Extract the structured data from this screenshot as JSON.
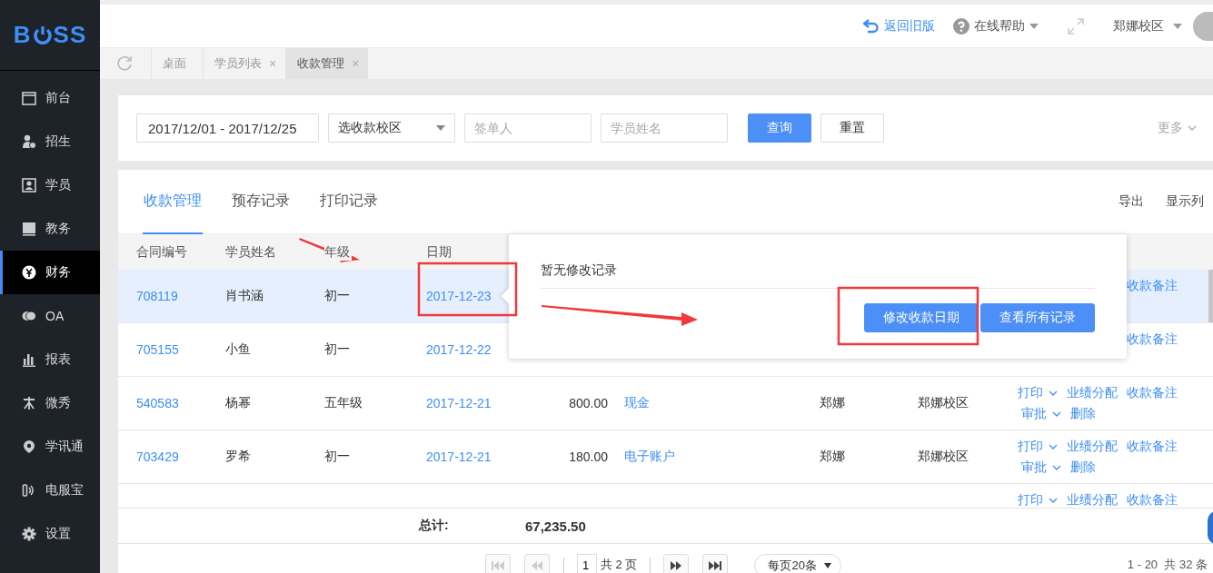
{
  "logo": {
    "left": "B",
    "right": "SS"
  },
  "sidebar": {
    "items": [
      {
        "label": "前台",
        "selected": false
      },
      {
        "label": "招生",
        "selected": false
      },
      {
        "label": "学员",
        "selected": false
      },
      {
        "label": "教务",
        "selected": false
      },
      {
        "label": "财务",
        "selected": true
      },
      {
        "label": "OA",
        "selected": false
      },
      {
        "label": "报表",
        "selected": false
      },
      {
        "label": "微秀",
        "selected": false
      },
      {
        "label": "学讯通",
        "selected": false
      },
      {
        "label": "电服宝",
        "selected": false
      },
      {
        "label": "设置",
        "selected": false
      }
    ]
  },
  "header": {
    "back_link": "返回旧版",
    "help": "在线帮助",
    "campus": "郑娜校区"
  },
  "page_tabs": [
    {
      "label": "桌面",
      "selected": false
    },
    {
      "label": "学员列表",
      "close": "×",
      "selected": false
    },
    {
      "label": "收款管理",
      "close": "×",
      "selected": true
    }
  ],
  "filters": {
    "date_range": "2017/12/01 - 2017/12/25",
    "campus_select": "选收款校区",
    "signer": {
      "placeholder": "签单人"
    },
    "student": {
      "placeholder": "学员姓名"
    },
    "search_button": "查询",
    "reset_button": "重置",
    "more": "更多"
  },
  "tabs": [
    {
      "label": "收款管理",
      "selected": true
    },
    {
      "label": "预存记录",
      "selected": false
    },
    {
      "label": "打印记录",
      "selected": false
    }
  ],
  "toolbar": [
    "导出",
    "显示列"
  ],
  "table": {
    "columns": [
      "合同编号",
      "学员姓名",
      "年级",
      "日期"
    ],
    "rows": [
      {
        "selected": true,
        "contract": "708119",
        "student": "肖书涵",
        "grade": "初一",
        "date": "2017-12-23",
        "actions": [
          {
            "label": "收款备注",
            "caret": false
          }
        ],
        "actions_2": []
      },
      {
        "selected": false,
        "contract": "705155",
        "student": "小鱼",
        "grade": "初一",
        "date": "2017-12-22",
        "actions": [
          {
            "label": "收款备注",
            "caret": false
          }
        ],
        "actions_2": []
      },
      {
        "selected": false,
        "contract": "540583",
        "student": "杨幂",
        "grade": "五年级",
        "date": "2017-12-21",
        "amount": "800.00",
        "method": "现金",
        "person": "郑娜",
        "campus": "郑娜校区",
        "actions": [
          {
            "label": "打印",
            "caret": true
          },
          {
            "label": "业绩分配",
            "caret": false
          },
          {
            "label": "收款备注",
            "caret": false
          }
        ],
        "actions_2": [
          {
            "label": "审批",
            "caret": true
          },
          {
            "label": "删除",
            "caret": false
          }
        ]
      },
      {
        "selected": false,
        "contract": "703429",
        "student": "罗希",
        "grade": "初一",
        "date": "2017-12-21",
        "amount": "180.00",
        "method": "电子账户",
        "person": "郑娜",
        "campus": "郑娜校区",
        "actions": [
          {
            "label": "打印",
            "caret": true
          },
          {
            "label": "业绩分配",
            "caret": false
          },
          {
            "label": "收款备注",
            "caret": false
          }
        ],
        "actions_2": [
          {
            "label": "审批",
            "caret": true
          },
          {
            "label": "删除",
            "caret": false
          }
        ]
      },
      {
        "selected": false,
        "actions": [
          {
            "label": "打印",
            "caret": true
          },
          {
            "label": "业绩分配",
            "caret": false
          },
          {
            "label": "收款备注",
            "caret": false
          }
        ],
        "actions_2": []
      }
    ]
  },
  "total": {
    "label": "总计:",
    "value": "67,235.50"
  },
  "popover": {
    "message": "暂无修改记录",
    "buttons": [
      "修改收款日期",
      "查看所有记录"
    ]
  },
  "pagination": {
    "page": "1",
    "pages": "共 2 页",
    "page_size": "每页20条",
    "summary": "1 - 20  共 32 条"
  }
}
